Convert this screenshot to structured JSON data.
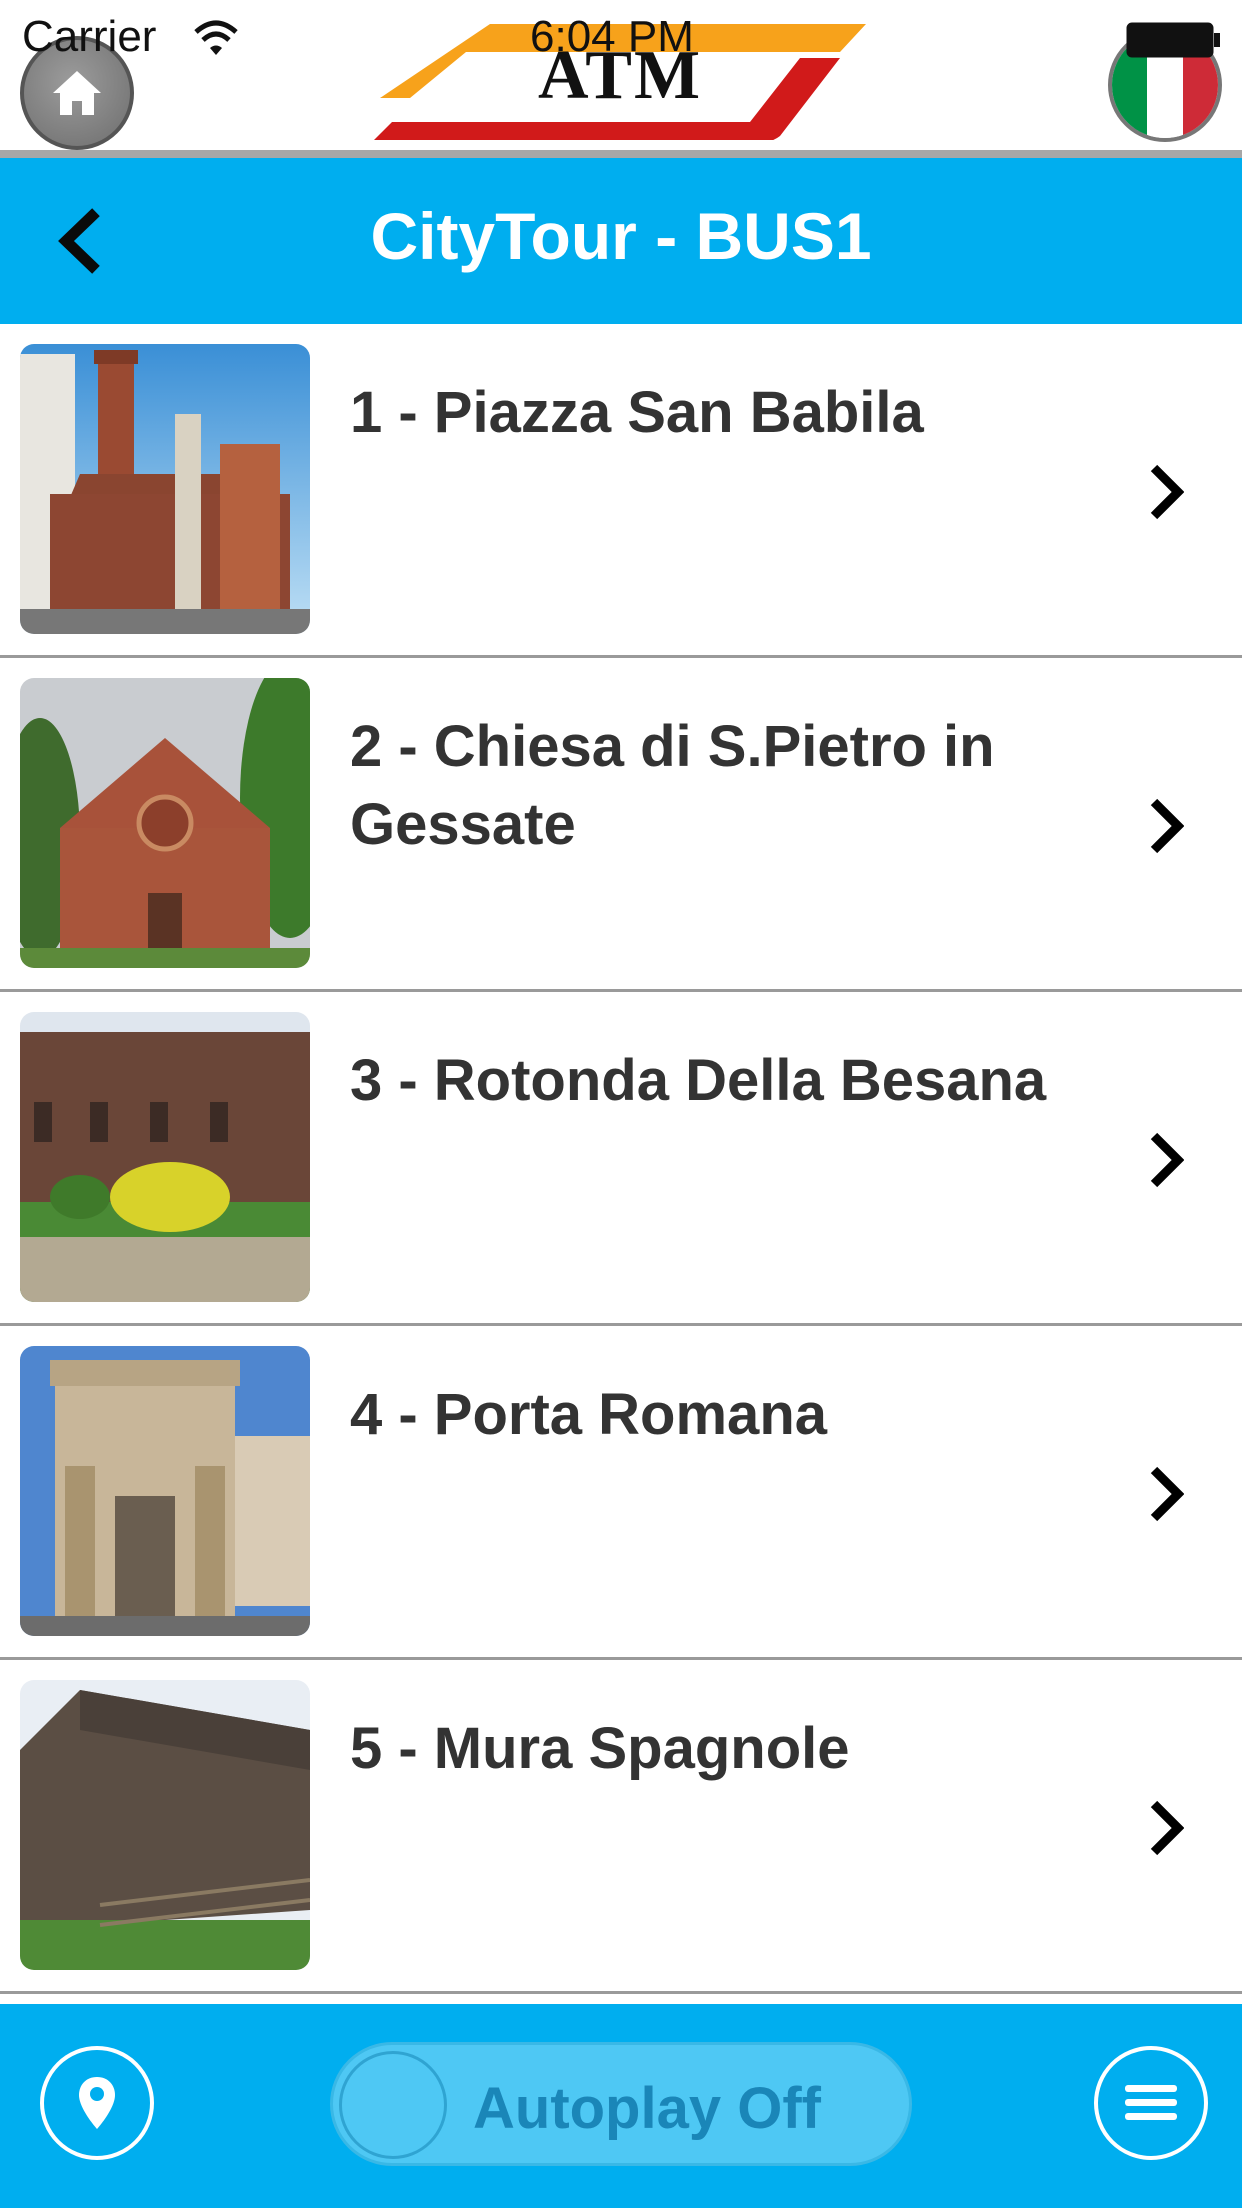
{
  "status_bar": {
    "carrier": "Carrier",
    "time": "6:04 PM"
  },
  "header": {
    "logo_text": "ATM",
    "language": "Italian",
    "flag_colors": [
      "#009246",
      "#ffffff",
      "#ce2b37"
    ]
  },
  "nav": {
    "title": "CityTour - BUS1"
  },
  "stops": [
    {
      "title": "1 - Piazza San Babila"
    },
    {
      "title": "2 - Chiesa di S.Pietro in Gessate"
    },
    {
      "title": "3 - Rotonda Della Besana"
    },
    {
      "title": "4 - Porta Romana"
    },
    {
      "title": "5 - Mura Spagnole"
    }
  ],
  "bottom_bar": {
    "autoplay_label": "Autoplay Off",
    "autoplay_on": false
  },
  "colors": {
    "accent": "#00aeef",
    "logo_orange": "#f7a21b",
    "logo_red": "#d11a1a"
  },
  "icons": [
    "home-icon",
    "wifi-icon",
    "battery-icon",
    "flag-icon",
    "back-icon",
    "chevron-right-icon",
    "map-pin-icon",
    "menu-icon"
  ]
}
